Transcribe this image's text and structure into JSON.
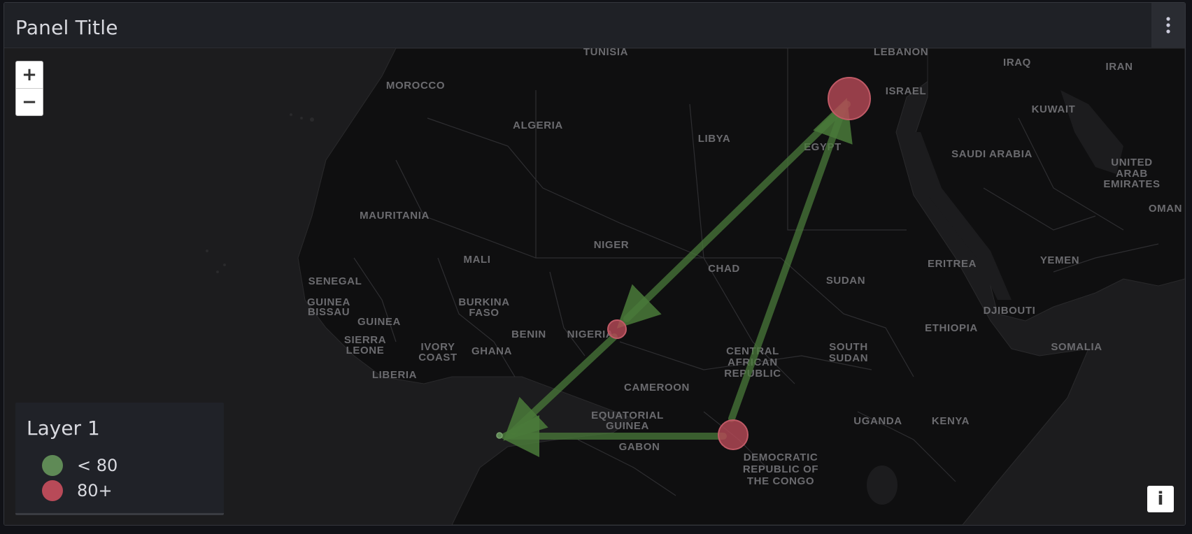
{
  "panel": {
    "title": "Panel Title"
  },
  "controls": {
    "zoom_in": "+",
    "zoom_out": "−",
    "info": "i"
  },
  "legend": {
    "title": "Layer 1",
    "items": [
      {
        "label": "< 80",
        "color": "#5f8a56"
      },
      {
        "label": "80+",
        "color": "#b84a58"
      }
    ]
  },
  "countries": [
    "TUNISIA",
    "LEBANON",
    "IRAQ",
    "IRAN",
    "MOROCCO",
    "ISRAEL",
    "KUWAIT",
    "ALGERIA",
    "LIBYA",
    "EGYPT",
    "SAUDI ARABIA",
    "UNITED",
    "ARAB",
    "EMIRATES",
    "OMAN",
    "MAURITANIA",
    "NIGER",
    "MALI",
    "CHAD",
    "SUDAN",
    "ERITREA",
    "YEMEN",
    "SENEGAL",
    "GUINEA",
    "BISSAU",
    "BURKINA",
    "FASO",
    "DJIBOUTI",
    "GUINEA",
    "BENIN",
    "NIGERIA",
    "ETHIOPIA",
    "SIERRA",
    "LEONE",
    "IVORY",
    "COAST",
    "GHANA",
    "CENTRAL",
    "AFRICAN",
    "REPUBLIC",
    "SOUTH",
    "SUDAN",
    "SOMALIA",
    "LIBERIA",
    "CAMEROON",
    "EQUATORIAL",
    "GUINEA",
    "UGANDA",
    "KENYA",
    "GABON",
    "DEMOCRATIC",
    "REPUBLIC OF",
    "THE CONGO"
  ],
  "markers": [
    {
      "place": "Egypt",
      "class": "80+"
    },
    {
      "place": "Nigeria",
      "class": "80+"
    },
    {
      "place": "DR Congo",
      "class": "80+"
    },
    {
      "place": "Gulf of Guinea",
      "class": "< 80"
    }
  ],
  "colors": {
    "arrow": "#4a7a3a",
    "high": "#b84a58",
    "low": "#5f8a56"
  }
}
